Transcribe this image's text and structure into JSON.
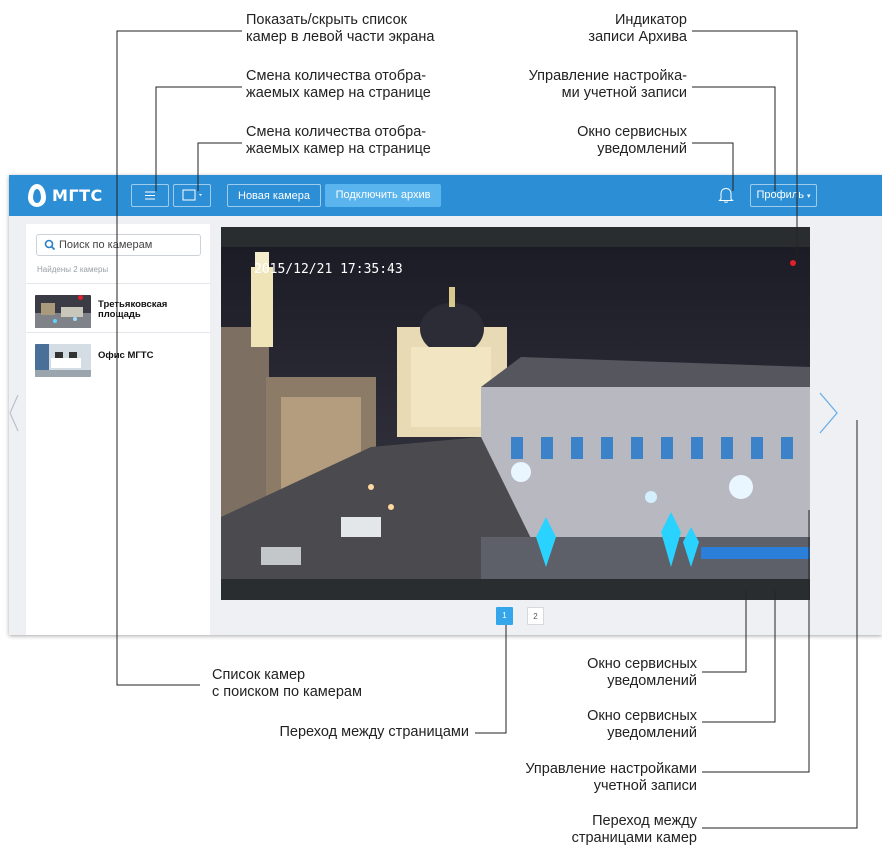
{
  "callouts": {
    "toggle_list": [
      "Показать/скрыть список",
      "камер в левой части экрана"
    ],
    "camera_count_1": [
      "Смена количества отобра-",
      "жаемых камер на странице"
    ],
    "camera_count_2": [
      "Смена количества отобра-",
      "жаемых камер на странице"
    ],
    "archive_indicator": [
      "Индикатор",
      "записи Архива"
    ],
    "account_settings": [
      "Управление настройка-",
      "ми учетной записи"
    ],
    "service_notifications_top": [
      "Окно сервисных",
      "уведомлений"
    ],
    "camera_list": [
      "Список камер",
      "с поиском по камерам"
    ],
    "pagination": [
      "Переход между страницами"
    ],
    "service_notifications_bottom_1": [
      "Окно сервисных",
      "уведомлений"
    ],
    "service_notifications_bottom_2": [
      "Окно сервисных",
      "уведомлений"
    ],
    "account_settings_bottom": [
      "Управление настройками",
      "учетной записи"
    ],
    "camera_pages": [
      "Переход между",
      "страницами камер"
    ]
  },
  "app": {
    "logo_text": "МГТС",
    "buttons": {
      "new_camera": "Новая камера",
      "connect_archive": "Подключить архив",
      "profile": "Профиль"
    },
    "sidebar": {
      "search_placeholder": "Поиск по камерам",
      "found_text": "Найдены 2 камеры",
      "cameras": [
        {
          "name": "Третьяковская площадь",
          "recording": true
        },
        {
          "name": "Офис МГТС",
          "recording": false
        }
      ]
    },
    "video": {
      "timestamp": "2015/12/21 17:35:43"
    },
    "pagination": {
      "pages": [
        "1",
        "2"
      ],
      "current": "1"
    }
  },
  "colors": {
    "brand_blue": "#2c8fd6",
    "accent_button": "#5ab4ee",
    "recording_red": "#e0202a"
  },
  "icons": [
    "menu-icon",
    "layout-icon",
    "bell-icon",
    "search-icon",
    "chevron-left-icon",
    "chevron-right-icon"
  ]
}
